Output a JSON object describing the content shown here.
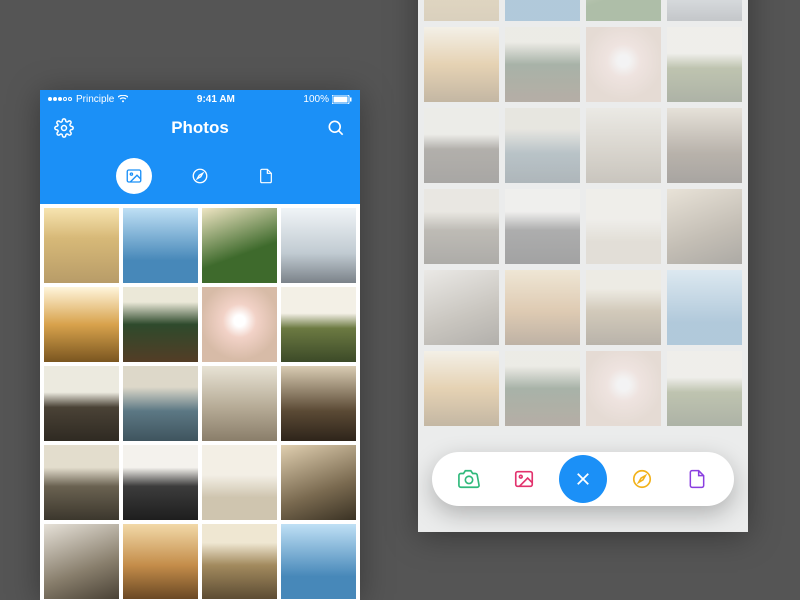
{
  "statusbar": {
    "carrier": "Principle",
    "time": "9:41 AM",
    "battery": "100%"
  },
  "navbar": {
    "title": "Photos"
  },
  "tabs": {
    "active_index": 0,
    "items": [
      {
        "name": "photos",
        "icon": "picture-icon"
      },
      {
        "name": "explore",
        "icon": "compass-icon"
      },
      {
        "name": "files",
        "icon": "document-icon"
      }
    ]
  },
  "actionbar": {
    "items": [
      {
        "name": "camera",
        "icon": "camera-icon",
        "color": "#2fb97b"
      },
      {
        "name": "picture",
        "icon": "picture-icon",
        "color": "#e2326d"
      },
      {
        "name": "close",
        "icon": "close-icon",
        "color": "#ffffff",
        "center": true
      },
      {
        "name": "compass",
        "icon": "compass-icon",
        "color": "#f2b21b"
      },
      {
        "name": "document",
        "icon": "document-icon",
        "color": "#8a3fe0"
      }
    ]
  },
  "colors": {
    "brand_blue": "#1b90f7",
    "bg_gray": "#555555",
    "right_bg": "#e8e9ea"
  },
  "grids": {
    "left_count": 20,
    "right_count": 24
  }
}
